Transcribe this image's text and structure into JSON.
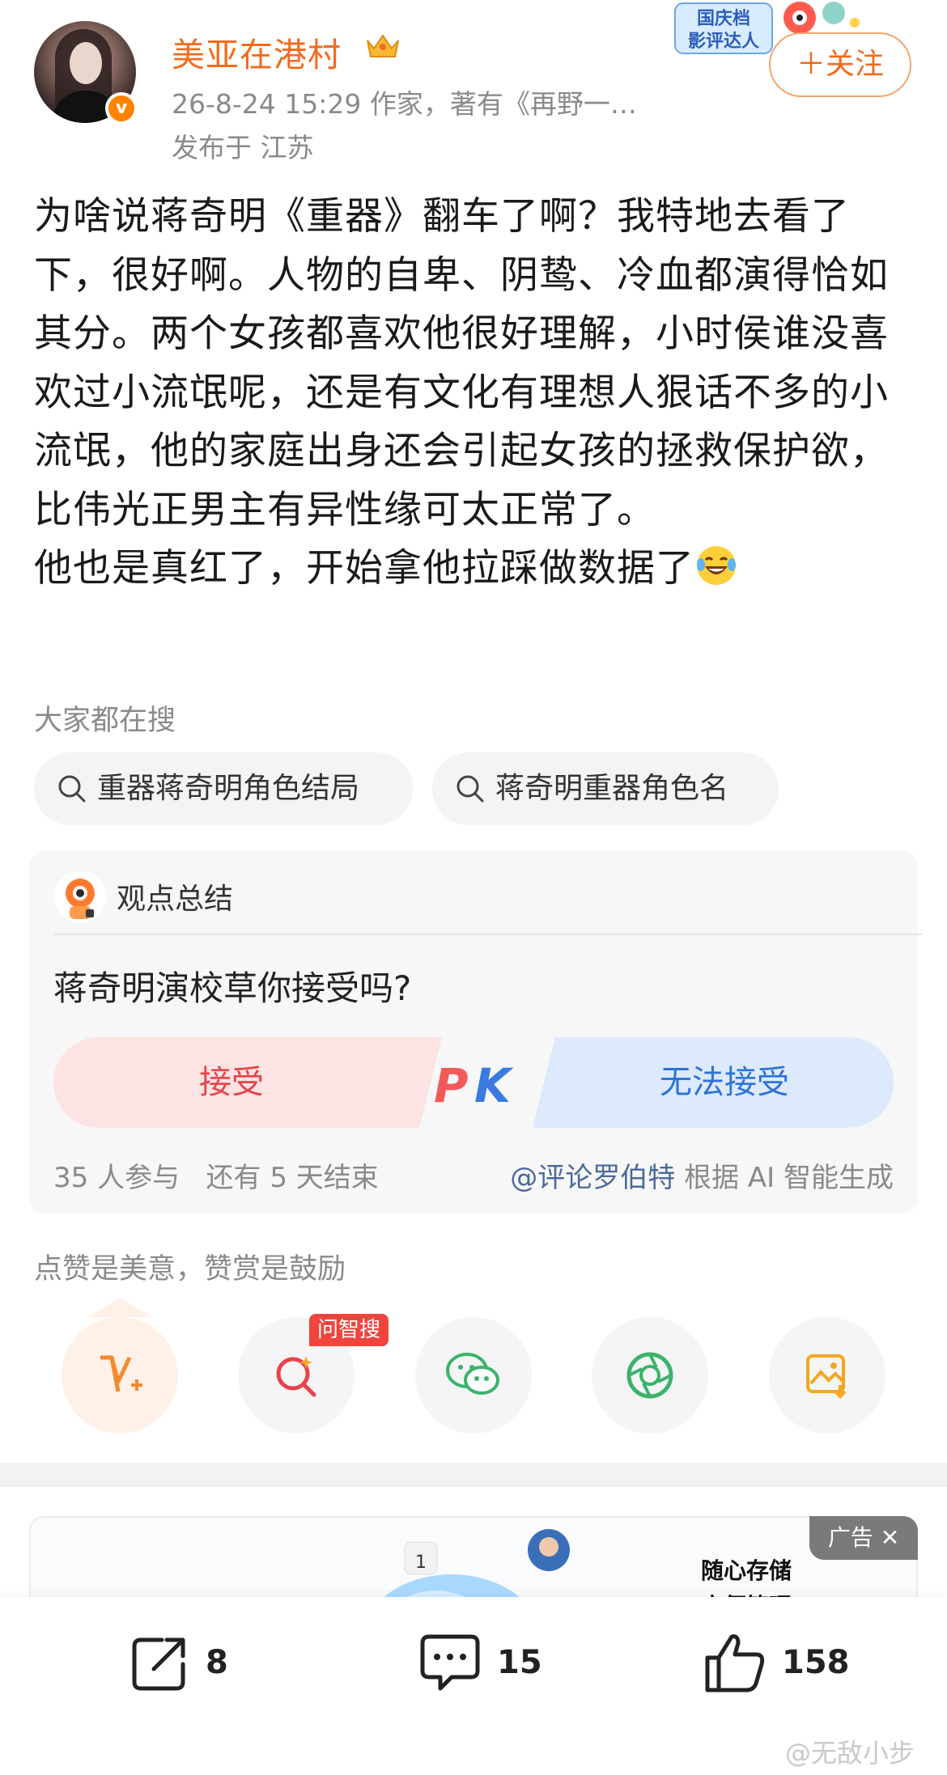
{
  "header": {
    "username": "美亚在港村",
    "meta": "26-8-24 15:29  作家，著有《再野一…",
    "location": "发布于 江苏",
    "follow_label": "＋关注",
    "verified_badge": "v",
    "promo_text_line1": "国庆档",
    "promo_text_line2": "影评达人"
  },
  "post": {
    "paragraph1": "为啥说蒋奇明《重器》翻车了啊？我特地去看了下，很好啊。人物的自卑、阴鸷、冷血都演得恰如其分。两个女孩都喜欢他很好理解，小时侯谁没喜欢过小流氓呢，还是有文化有理想人狠话不多的小流氓，他的家庭出身还会引起女孩的拯救保护欲，比伟光正男主有异性缘可太正常了。",
    "paragraph2": "他也是真红了，开始拿他拉踩做数据了",
    "emoji": "laugh-cry-emoji"
  },
  "search": {
    "title": "大家都在搜",
    "chips": [
      "重器蒋奇明角色结局",
      "蒋奇明重器角色名"
    ]
  },
  "opinion": {
    "title": "观点总结",
    "question": "蒋奇明演校草你接受吗?",
    "option_left": "接受",
    "option_right": "无法接受",
    "pk": "PK",
    "participants": "35 人参与",
    "remaining": "还有 5 天结束",
    "mention": "@评论罗伯特",
    "generated": "根据 AI 智能生成",
    "colors": {
      "left": "#fde3e3",
      "right": "#ddeafc",
      "pk_red": "#f25a5a",
      "pk_blue": "#3a7ae0"
    }
  },
  "reward": {
    "title": "点赞是美意，赞赏是鼓励",
    "wenzhi_label": "问智搜",
    "buttons": [
      "reward-v-icon",
      "ai-search-icon",
      "wechat-icon",
      "moments-icon",
      "save-image-icon"
    ]
  },
  "ad": {
    "badge": "广告 ✕",
    "line1": "随心存储",
    "line2": "方便管理"
  },
  "bottom": {
    "share_count": "8",
    "comment_count": "15",
    "like_count": "158"
  },
  "watermark": "@无敌小步",
  "accent_color": "#f26b1d"
}
